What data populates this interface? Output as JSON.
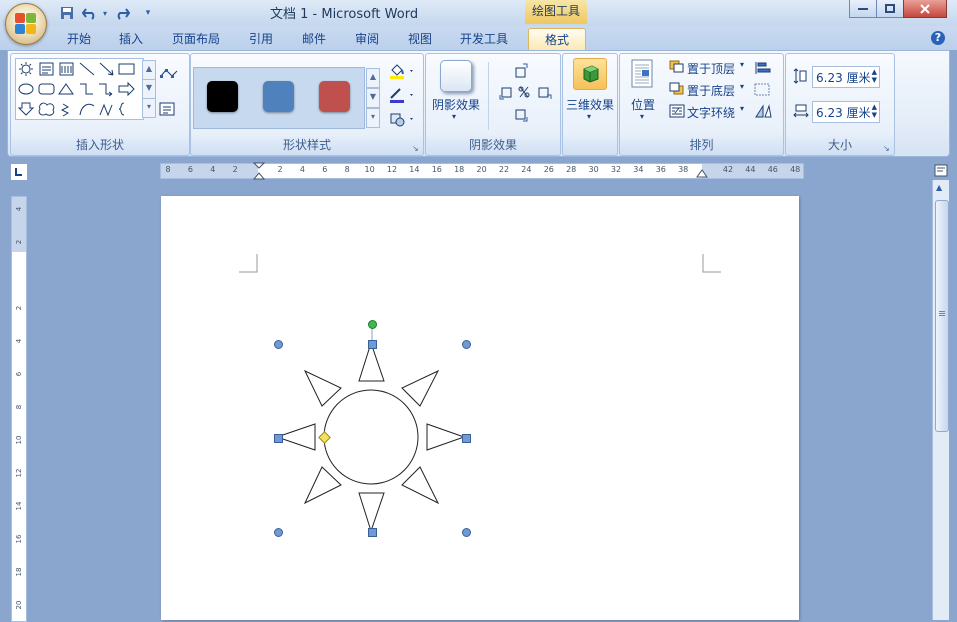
{
  "app": {
    "document_title": "文档 1 - Microsoft Word",
    "context_tab_title": "绘图工具"
  },
  "ribbon_tabs": [
    "开始",
    "插入",
    "页面布局",
    "引用",
    "邮件",
    "审阅",
    "视图",
    "开发工具",
    "格式"
  ],
  "active_tab": "格式",
  "groups": {
    "insert_shapes": {
      "label": "插入形状"
    },
    "shape_styles": {
      "label": "形状样式",
      "swatch_colors": [
        "#000000",
        "#4f81bd",
        "#c0504d"
      ]
    },
    "shadow_effects": {
      "label": "阴影效果",
      "button_label": "阴影效果"
    },
    "three_d": {
      "button_label": "三维效果"
    },
    "arrange": {
      "label": "排列",
      "position_label": "位置",
      "bring_to_front": "置于顶层",
      "send_to_back": "置于底层",
      "text_wrap": "文字环绕"
    },
    "size": {
      "label": "大小",
      "height": "6.23 厘米",
      "width": "6.23 厘米"
    }
  },
  "ruler": {
    "horizontal_labels": [
      "8",
      "6",
      "4",
      "2",
      "",
      "2",
      "4",
      "6",
      "8",
      "10",
      "12",
      "14",
      "16",
      "18",
      "20",
      "22",
      "24",
      "26",
      "28",
      "30",
      "32",
      "34",
      "36",
      "38",
      "",
      "42",
      "44",
      "46",
      "48"
    ],
    "vertical_labels": [
      "4",
      "2",
      "",
      "2",
      "4",
      "6",
      "8",
      "10",
      "12",
      "14",
      "16",
      "18",
      "20"
    ]
  },
  "icons": {
    "orb": "office-logo-icon",
    "save": "save-icon",
    "undo": "undo-icon",
    "redo": "redo-icon",
    "help": "help-icon"
  },
  "accent_colors": {
    "selection_handle": "#6f9ad3",
    "rotation_handle": "#3dbb4a",
    "adjust_handle": "#f4e15a"
  }
}
